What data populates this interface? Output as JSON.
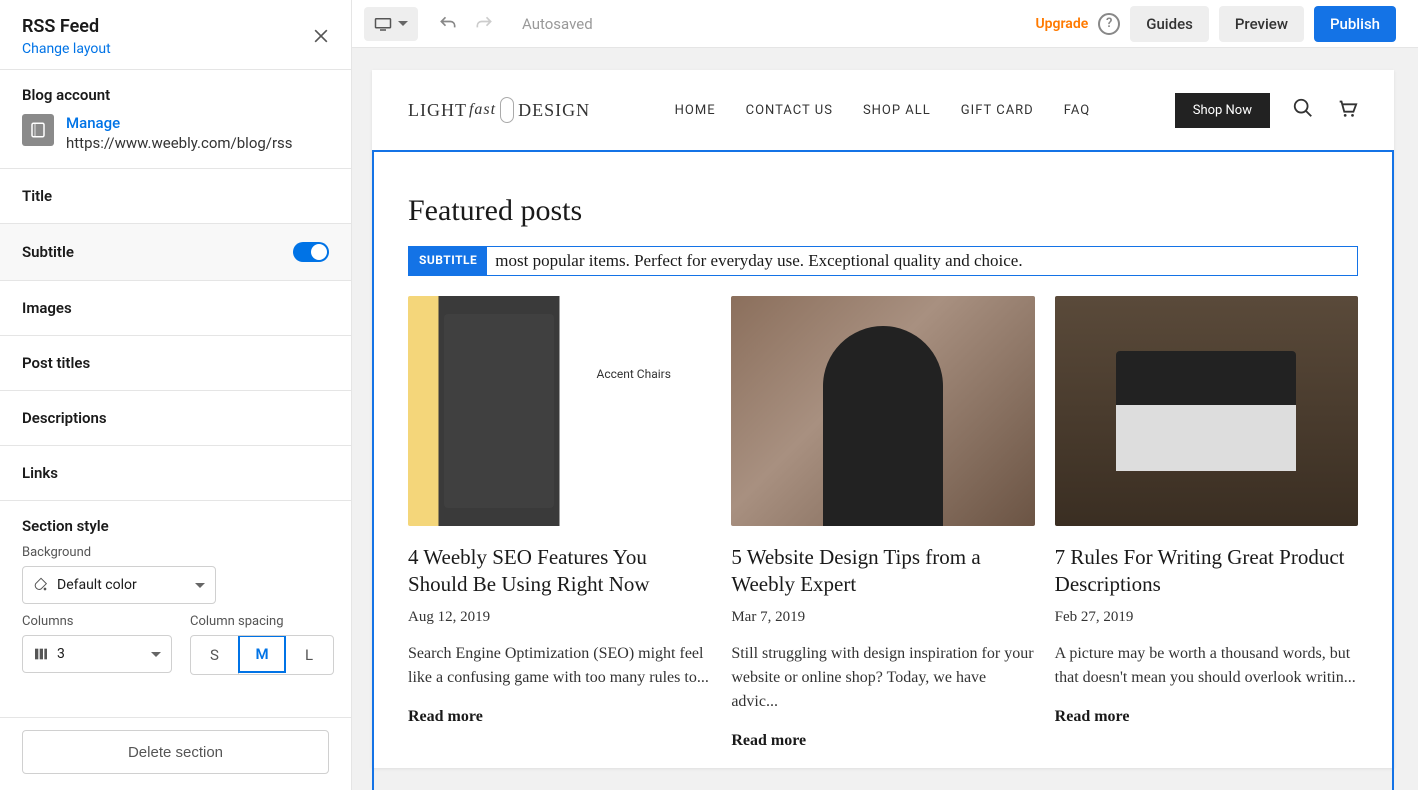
{
  "sidebar": {
    "title": "RSS Feed",
    "change_layout": "Change layout",
    "blog_heading": "Blog account",
    "manage": "Manage",
    "blog_url": "https://www.weebly.com/blog/rss",
    "items": {
      "title": "Title",
      "subtitle": "Subtitle",
      "images": "Images",
      "post_titles": "Post titles",
      "descriptions": "Descriptions",
      "links": "Links"
    },
    "style_heading": "Section style",
    "background_label": "Background",
    "background_value": "Default color",
    "columns_label": "Columns",
    "columns_value": "3",
    "spacing_label": "Column spacing",
    "spacing": {
      "s": "S",
      "m": "M",
      "l": "L"
    },
    "delete": "Delete section"
  },
  "topbar": {
    "autosaved": "Autosaved",
    "upgrade": "Upgrade",
    "guides": "Guides",
    "preview": "Preview",
    "publish": "Publish"
  },
  "site": {
    "logo": {
      "light": "LIGHT",
      "fast": "fast",
      "design": "DESIGN"
    },
    "nav": [
      "HOME",
      "CONTACT US",
      "SHOP ALL",
      "GIFT CARD",
      "FAQ"
    ],
    "shop_now": "Shop Now",
    "featured_title": "Featured posts",
    "subtitle_badge": "SUBTITLE",
    "subtitle_text": "most popular items. Perfect for everyday use. Exceptional quality and choice.",
    "posts": [
      {
        "title": "4 Weebly SEO Features You Should Be Using Right Now",
        "date": "Aug 12, 2019",
        "desc": "Search Engine Optimization (SEO) might feel like a confusing game with too many rules to...",
        "read": "Read more"
      },
      {
        "title": "5 Website Design Tips from a Weebly Expert",
        "date": "Mar 7, 2019",
        "desc": "Still struggling with design inspiration for your website or online shop? Today, we have advic...",
        "read": "Read more"
      },
      {
        "title": "7 Rules For Writing Great Product Descriptions",
        "date": "Feb 27, 2019",
        "desc": "A picture may be worth a thousand words, but that doesn't mean you should overlook writin...",
        "read": "Read more"
      }
    ]
  }
}
